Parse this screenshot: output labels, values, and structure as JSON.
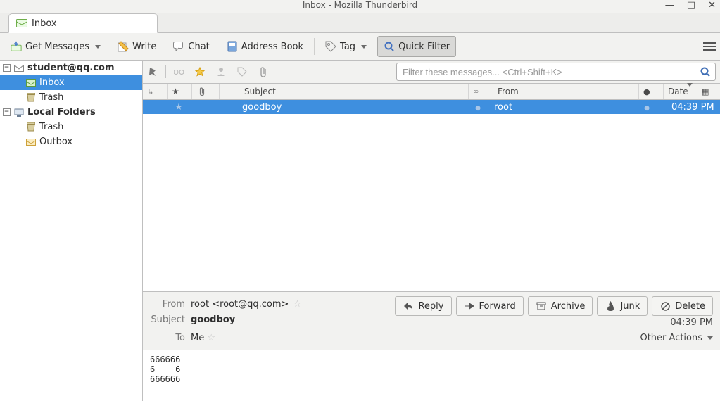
{
  "window": {
    "title": "Inbox - Mozilla Thunderbird"
  },
  "tab": {
    "label": "Inbox"
  },
  "toolbar": {
    "get_messages": "Get Messages",
    "write": "Write",
    "chat": "Chat",
    "address_book": "Address Book",
    "tag": "Tag",
    "quick_filter": "Quick Filter"
  },
  "accounts": {
    "a0": {
      "name": "student@qq.com",
      "folders": {
        "inbox": "Inbox",
        "trash": "Trash"
      }
    },
    "local": {
      "name": "Local Folders",
      "folders": {
        "trash": "Trash",
        "outbox": "Outbox"
      }
    }
  },
  "filter": {
    "placeholder": "Filter these messages... <Ctrl+Shift+K>"
  },
  "columns": {
    "subject": "Subject",
    "from": "From",
    "date": "Date"
  },
  "messages": {
    "m0": {
      "subject": "goodboy",
      "from": "root",
      "date": "04:39 PM"
    }
  },
  "preview": {
    "labels": {
      "from": "From",
      "subject": "Subject",
      "to": "To"
    },
    "from": "root <root@qq.com>",
    "subject": "goodboy",
    "to": "Me",
    "date": "04:39 PM",
    "actions": {
      "reply": "Reply",
      "forward": "Forward",
      "archive": "Archive",
      "junk": "Junk",
      "delete": "Delete"
    },
    "other_actions": "Other Actions",
    "body": "666666\n6    6\n666666"
  }
}
